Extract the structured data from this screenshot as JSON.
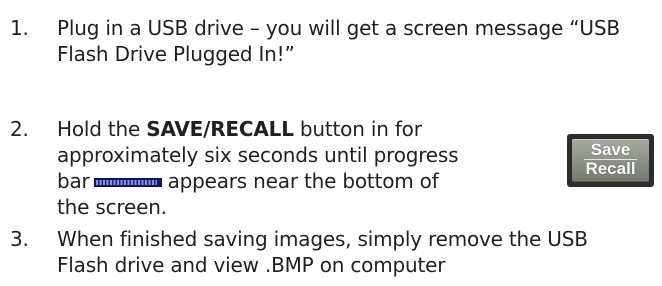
{
  "steps": [
    {
      "number": "1.",
      "lines": [
        "Plug in a USB drive – you will get a screen message “USB",
        "Flash Drive Plugged In!”"
      ]
    },
    {
      "number": "2.",
      "line1_before": "Hold the ",
      "line1_bold": "SAVE/RECALL",
      "line1_after": " button in for",
      "line2": "approximately six seconds until progress",
      "line3_before": "bar",
      "line3_after": "appears near the bottom of",
      "line4": "the screen.",
      "progress_bar_fill": 0.96
    },
    {
      "number": "3.",
      "lines": [
        "When finished saving images, simply remove the USB",
        "Flash drive and view .BMP on computer"
      ]
    }
  ],
  "device_button": {
    "top_label": "Save",
    "bottom_label": "Recall"
  }
}
